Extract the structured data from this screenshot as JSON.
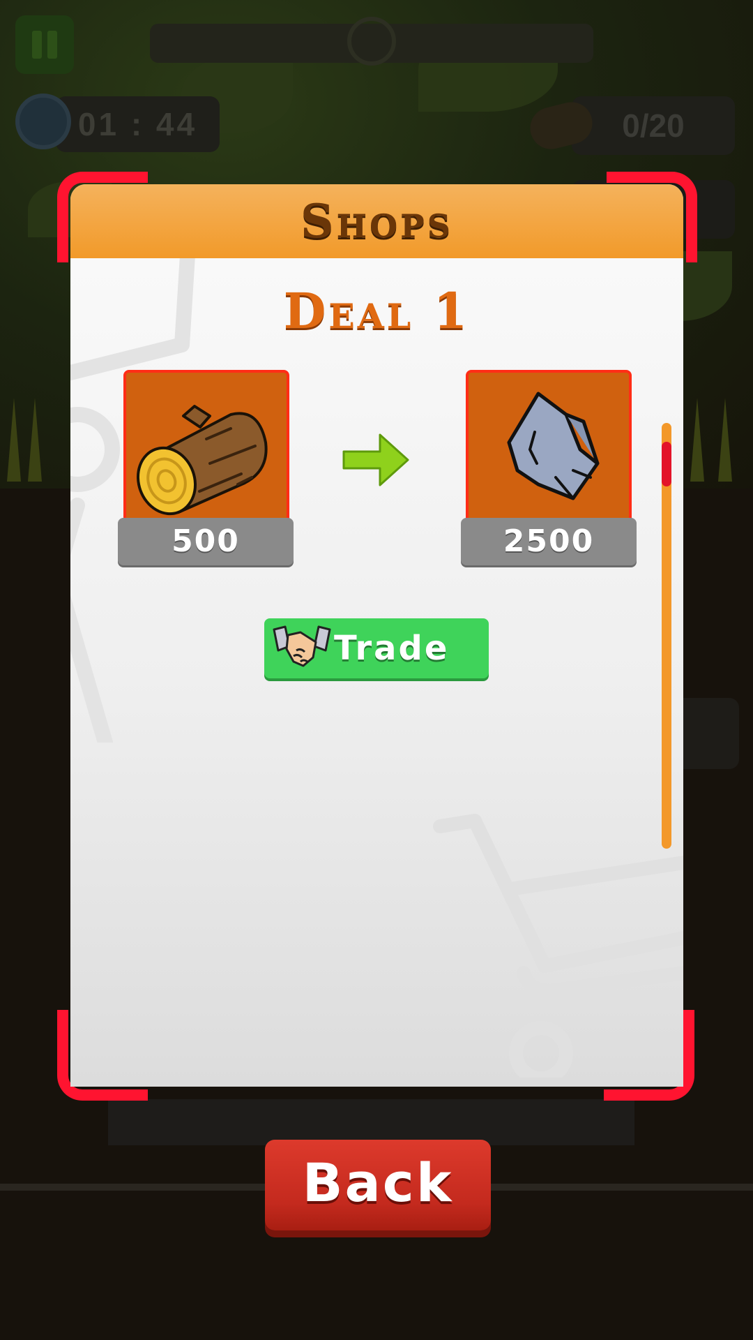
{
  "hud": {
    "timer": "01 : 44",
    "log_counter": "0/20"
  },
  "shop": {
    "title": "Shops",
    "deal_title": "Deal 1",
    "give_item": {
      "icon": "wood-log-icon",
      "amount": "500"
    },
    "get_item": {
      "icon": "stone-icon",
      "amount": "2500"
    },
    "trade_label": "Trade",
    "scroll_position": 0.05
  },
  "back_label": "Back",
  "colors": {
    "header_orange": "#f29a2a",
    "frame_red": "#ff1430",
    "card_orange": "#d0610f",
    "trade_green": "#3fd35a",
    "back_red": "#c42a1e",
    "title_brown": "#6a3608",
    "deal_orange": "#e06a12"
  }
}
